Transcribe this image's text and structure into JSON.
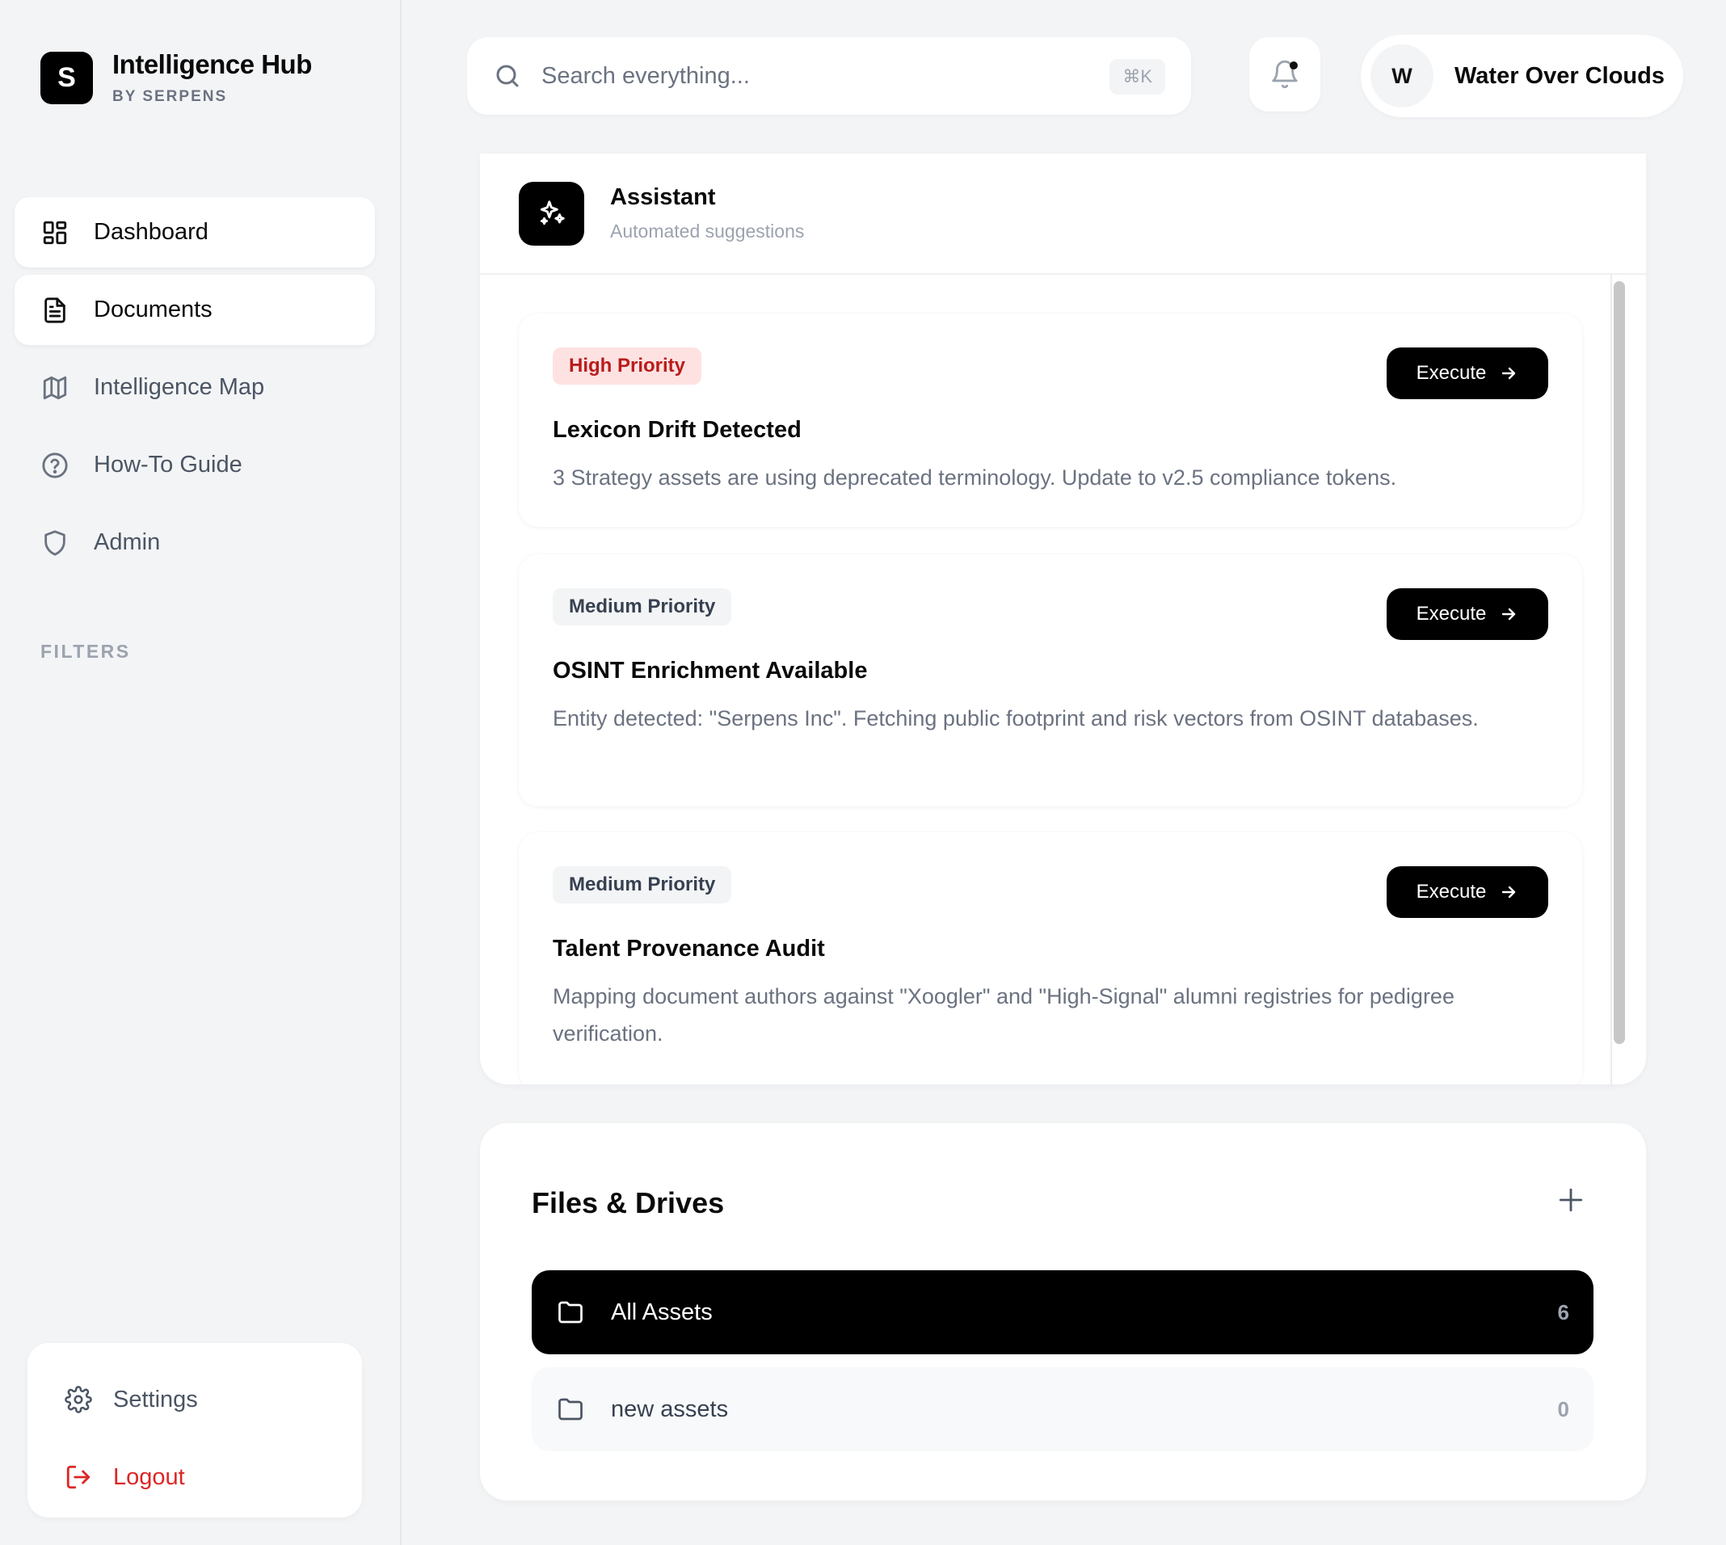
{
  "brand": {
    "logo_letter": "S",
    "title": "Intelligence Hub",
    "subtitle": "BY SERPENS"
  },
  "nav": [
    {
      "label": "Dashboard",
      "icon": "dashboard-grid-icon",
      "active": true
    },
    {
      "label": "Documents",
      "icon": "document-icon",
      "active": true
    },
    {
      "label": "Intelligence Map",
      "icon": "map-icon",
      "active": false
    },
    {
      "label": "How-To Guide",
      "icon": "help-circle-icon",
      "active": false
    },
    {
      "label": "Admin",
      "icon": "shield-icon",
      "active": false
    }
  ],
  "filters_label": "FILTERS",
  "bottom": {
    "settings": "Settings",
    "logout": "Logout"
  },
  "search": {
    "placeholder": "Search everything...",
    "shortcut": "⌘K"
  },
  "user": {
    "initial": "W",
    "name": "Water Over Clouds"
  },
  "assistant": {
    "title": "Assistant",
    "subtitle": "Automated suggestions",
    "execute_label": "Execute",
    "cards": [
      {
        "priority": "High Priority",
        "level": "high",
        "title": "Lexicon Drift Detected",
        "description": "3 Strategy assets are using deprecated terminology. Update to v2.5 compliance tokens."
      },
      {
        "priority": "Medium Priority",
        "level": "medium",
        "title": "OSINT Enrichment Available",
        "description": "Entity detected: \"Serpens Inc\". Fetching public footprint and risk vectors from OSINT databases."
      },
      {
        "priority": "Medium Priority",
        "level": "medium",
        "title": "Talent Provenance Audit",
        "description": "Mapping document authors against \"Xoogler\" and \"High-Signal\" alumni registries for pedigree verification."
      }
    ]
  },
  "files": {
    "title": "Files & Drives",
    "folders": [
      {
        "name": "All Assets",
        "count": "6",
        "active": true
      },
      {
        "name": "new assets",
        "count": "0",
        "active": false
      }
    ]
  },
  "colors": {
    "accent": "#000000",
    "high_priority_bg": "#fee2e2",
    "high_priority_text": "#b91c1c",
    "logout": "#dc2626"
  }
}
